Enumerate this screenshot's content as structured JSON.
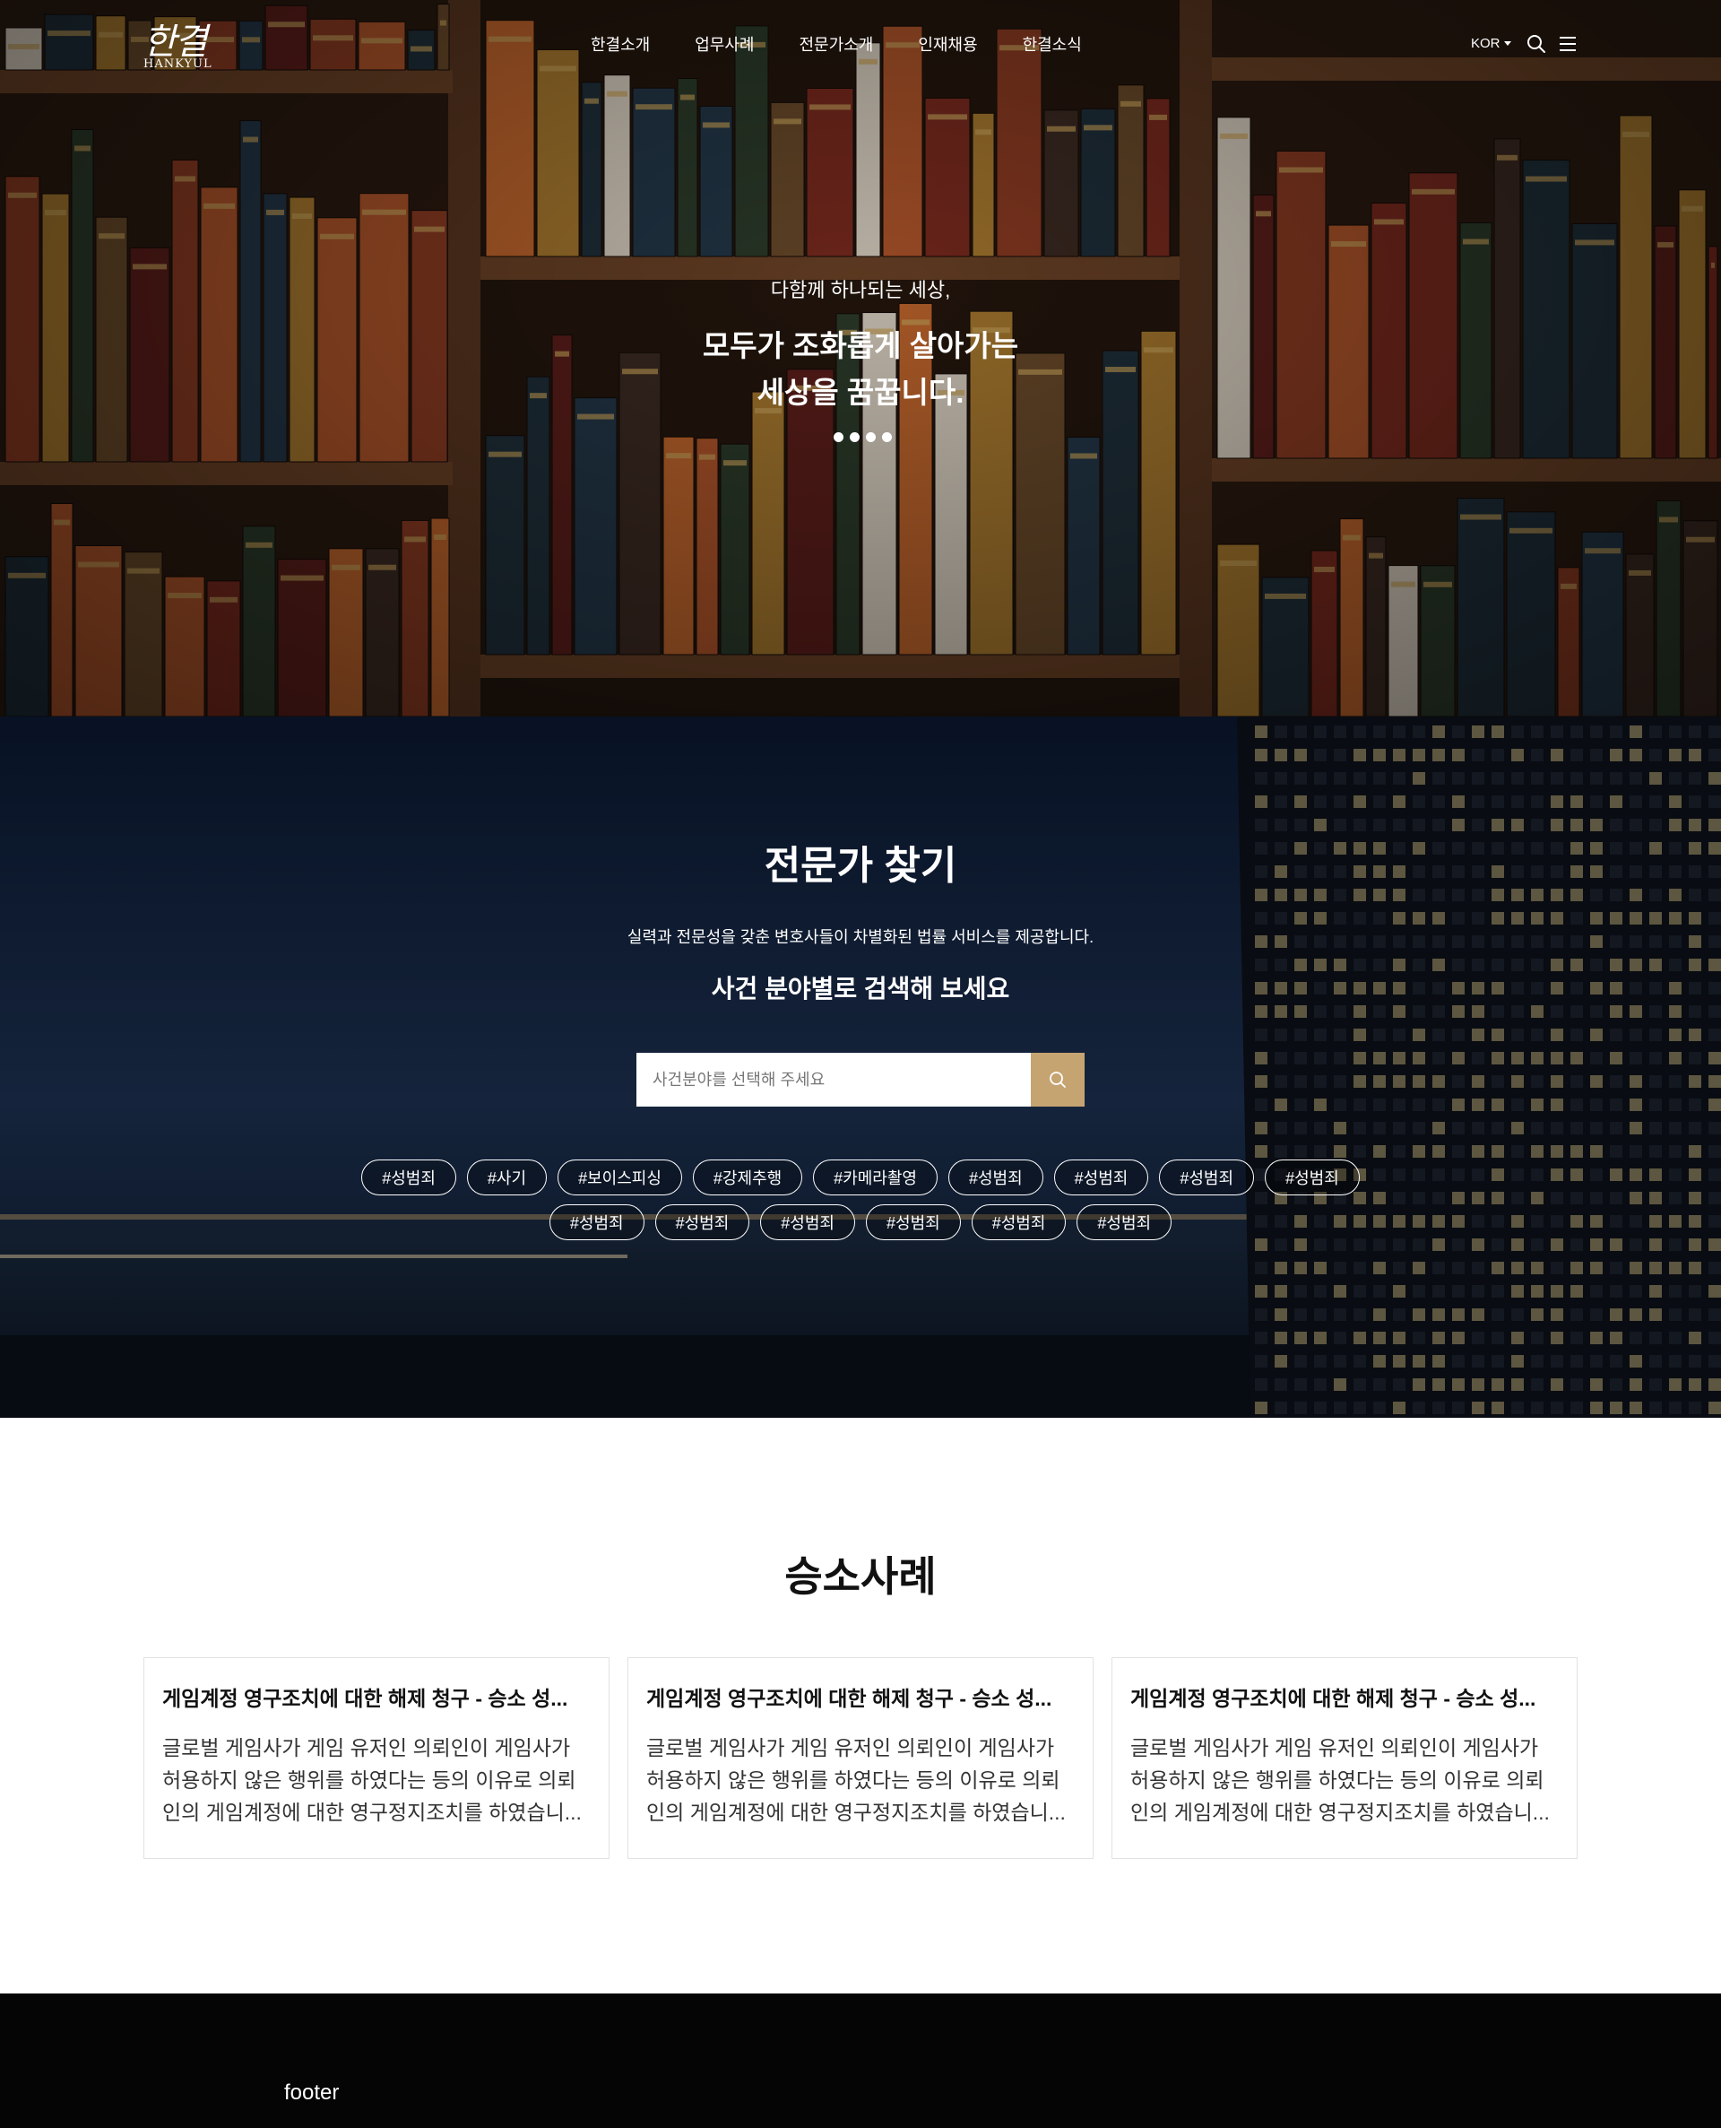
{
  "header": {
    "logo_ko": "한결",
    "logo_en": "HANKYUL",
    "menu": [
      "한결소개",
      "업무사례",
      "전문가소개",
      "인재채용",
      "한결소식"
    ],
    "language": "KOR"
  },
  "hero": {
    "subtitle": "다함께 하나되는 세상,",
    "title_line1": "모두가 조화롭게 살아가는",
    "title_line2": "세상을 꿈꿉니다.",
    "slide_count": 4
  },
  "finder": {
    "title": "전문가 찾기",
    "description": "실력과 전문성을 갖춘 변호사들이 차별화된 법률 서비스를 제공합니다.",
    "subtitle": "사건 분야별로 검색해 보세요",
    "placeholder": "사건분야를 선택해 주세요",
    "tags": [
      "#성범죄",
      "#사기",
      "#보이스피싱",
      "#강제추행",
      "#카메라촬영",
      "#성범죄",
      "#성범죄",
      "#성범죄",
      "#성범죄",
      "#성범죄",
      "#성범죄",
      "#성범죄",
      "#성범죄",
      "#성범죄",
      "#성범죄"
    ],
    "accent_color": "#c6a472"
  },
  "cases": {
    "title": "승소사례",
    "items": [
      {
        "title": "게임계정 영구조치에 대한 해제 청구 - 승소 성...",
        "body": "글로벌 게임사가 게임 유저인 의뢰인이 게임사가 허용하지 않은 행위를 하였다는 등의 이유로 의뢰인의 게임계정에 대한 영구정지조치를 하였습니..."
      },
      {
        "title": "게임계정 영구조치에 대한 해제 청구 - 승소 성...",
        "body": "글로벌 게임사가 게임 유저인 의뢰인이 게임사가 허용하지 않은 행위를 하였다는 등의 이유로 의뢰인의 게임계정에 대한 영구정지조치를 하였습니..."
      },
      {
        "title": "게임계정 영구조치에 대한 해제 청구 - 승소 성...",
        "body": "글로벌 게임사가 게임 유저인 의뢰인이 게임사가 허용하지 않은 행위를 하였다는 등의 이유로 의뢰인의 게임계정에 대한 영구정지조치를 하였습니..."
      }
    ]
  },
  "footer": {
    "text": "footer"
  },
  "icons": [
    "search-icon",
    "menu-icon",
    "caret-down-icon"
  ]
}
